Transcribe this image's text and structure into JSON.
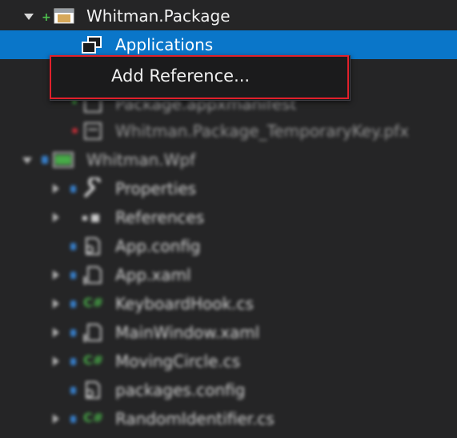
{
  "tree": {
    "project_package": {
      "label": "Whitman.Package",
      "icon": "package-project-icon"
    },
    "applications": {
      "label": "Applications",
      "icon": "applications-folder-icon"
    },
    "package_manifest": {
      "label": "Package.appxmanifest"
    },
    "temp_key": {
      "label": "Whitman.Package_TemporaryKey.pfx"
    },
    "project_wpf": {
      "label": "Whitman.Wpf"
    },
    "items": [
      {
        "label": "Properties",
        "icon": "wrench-icon"
      },
      {
        "label": "References",
        "icon": "references-icon"
      },
      {
        "label": "App.config",
        "icon": "config-icon"
      },
      {
        "label": "App.xaml",
        "icon": "xaml-icon"
      },
      {
        "label": "KeyboardHook.cs",
        "icon": "csharp-icon"
      },
      {
        "label": "MainWindow.xaml",
        "icon": "xaml-icon"
      },
      {
        "label": "MovingCircle.cs",
        "icon": "csharp-icon"
      },
      {
        "label": "packages.config",
        "icon": "config-icon"
      },
      {
        "label": "RandomIdentifier.cs",
        "icon": "csharp-icon"
      }
    ]
  },
  "context_menu": {
    "add_reference": "Add Reference..."
  },
  "colors": {
    "background": "#252526",
    "selection": "#0a76c9",
    "menu_bg": "#1b1b1c",
    "highlight_border": "#e0202b",
    "csharp_green": "#4ec34e",
    "lock_blue": "#3a8ee6"
  }
}
